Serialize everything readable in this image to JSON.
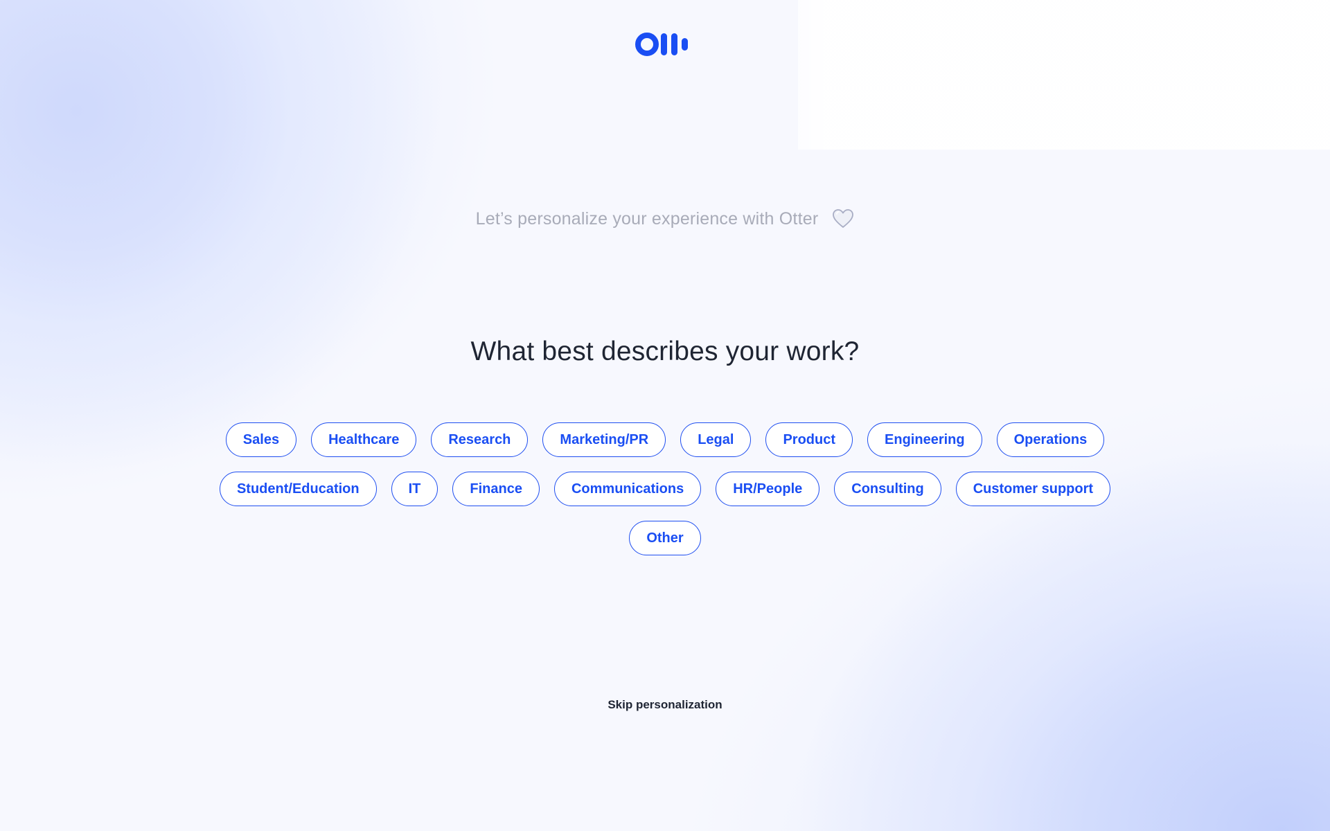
{
  "brand": {
    "logo_icon": "otter-logo-icon",
    "accent_color": "#1a4ef3"
  },
  "header": {
    "subtitle": "Let’s personalize your experience with Otter",
    "heart_icon": "heart-icon"
  },
  "main": {
    "question": "What best describes your work?",
    "rows": [
      [
        "Sales",
        "Healthcare",
        "Research",
        "Marketing/PR",
        "Legal",
        "Product",
        "Engineering",
        "Operations"
      ],
      [
        "Student/Education",
        "IT",
        "Finance",
        "Communications",
        "HR/People",
        "Consulting",
        "Customer support"
      ],
      [
        "Other"
      ]
    ]
  },
  "footer": {
    "skip_label": "Skip personalization"
  }
}
